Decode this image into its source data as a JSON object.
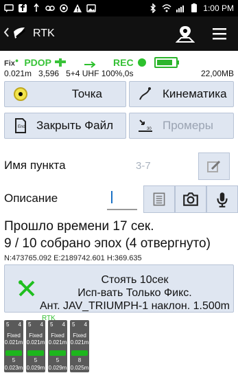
{
  "statusbar": {
    "time": "1:00 PM"
  },
  "app": {
    "title": "RTK"
  },
  "status": {
    "fix_label": "Fix",
    "pdop_label": "PDOP",
    "rec_label": "REC",
    "battery_level_fraction": 0.85,
    "colors": {
      "accent_green": "#2dc12d",
      "button_bg": "#dfe6f1"
    },
    "info": {
      "left_a": "0.021m",
      "left_b": "3,596",
      "left_c": "5+4 UHF 100%,0s",
      "right": "22,00MB"
    }
  },
  "buttons": {
    "point": "Точка",
    "kinematics": "Кинематика",
    "close_file": "Закрыть Файл",
    "measurements": "Промеры"
  },
  "fields": {
    "point_name_label": "Имя пункта",
    "point_name_value": "3-7",
    "description_label": "Описание"
  },
  "messages": {
    "elapsed": "Прошло времени 17 сек.",
    "epochs": "9 / 10 собрано эпох (4 отвергнуто)",
    "coords": "N:473765.092 E:2189742.601 H:369.635"
  },
  "bottom": {
    "line1": "Стоять 10сек",
    "line2": "Исп-вать Только Фикс.",
    "line3": "Ант. JAV_TRIUMPH-1  наклон. 1.500m"
  },
  "rtk": {
    "label": "RTK",
    "cells": [
      {
        "top_left": "5",
        "top_right": "4",
        "status": "Fixed",
        "precision": "0.021m",
        "mid": "5",
        "bottom": "0.023m"
      },
      {
        "top_left": "5",
        "top_right": "4",
        "status": "Fixed",
        "precision": "0.021m",
        "mid": "5",
        "bottom": "0.029m"
      },
      {
        "top_left": "5",
        "top_right": "4",
        "status": "Fixed",
        "precision": "0.021m",
        "mid": "5",
        "bottom": "0.029m"
      },
      {
        "top_left": "5",
        "top_right": "4",
        "status": "Fixed",
        "precision": "0.021m",
        "mid": "8",
        "bottom": "0.025m"
      }
    ]
  }
}
